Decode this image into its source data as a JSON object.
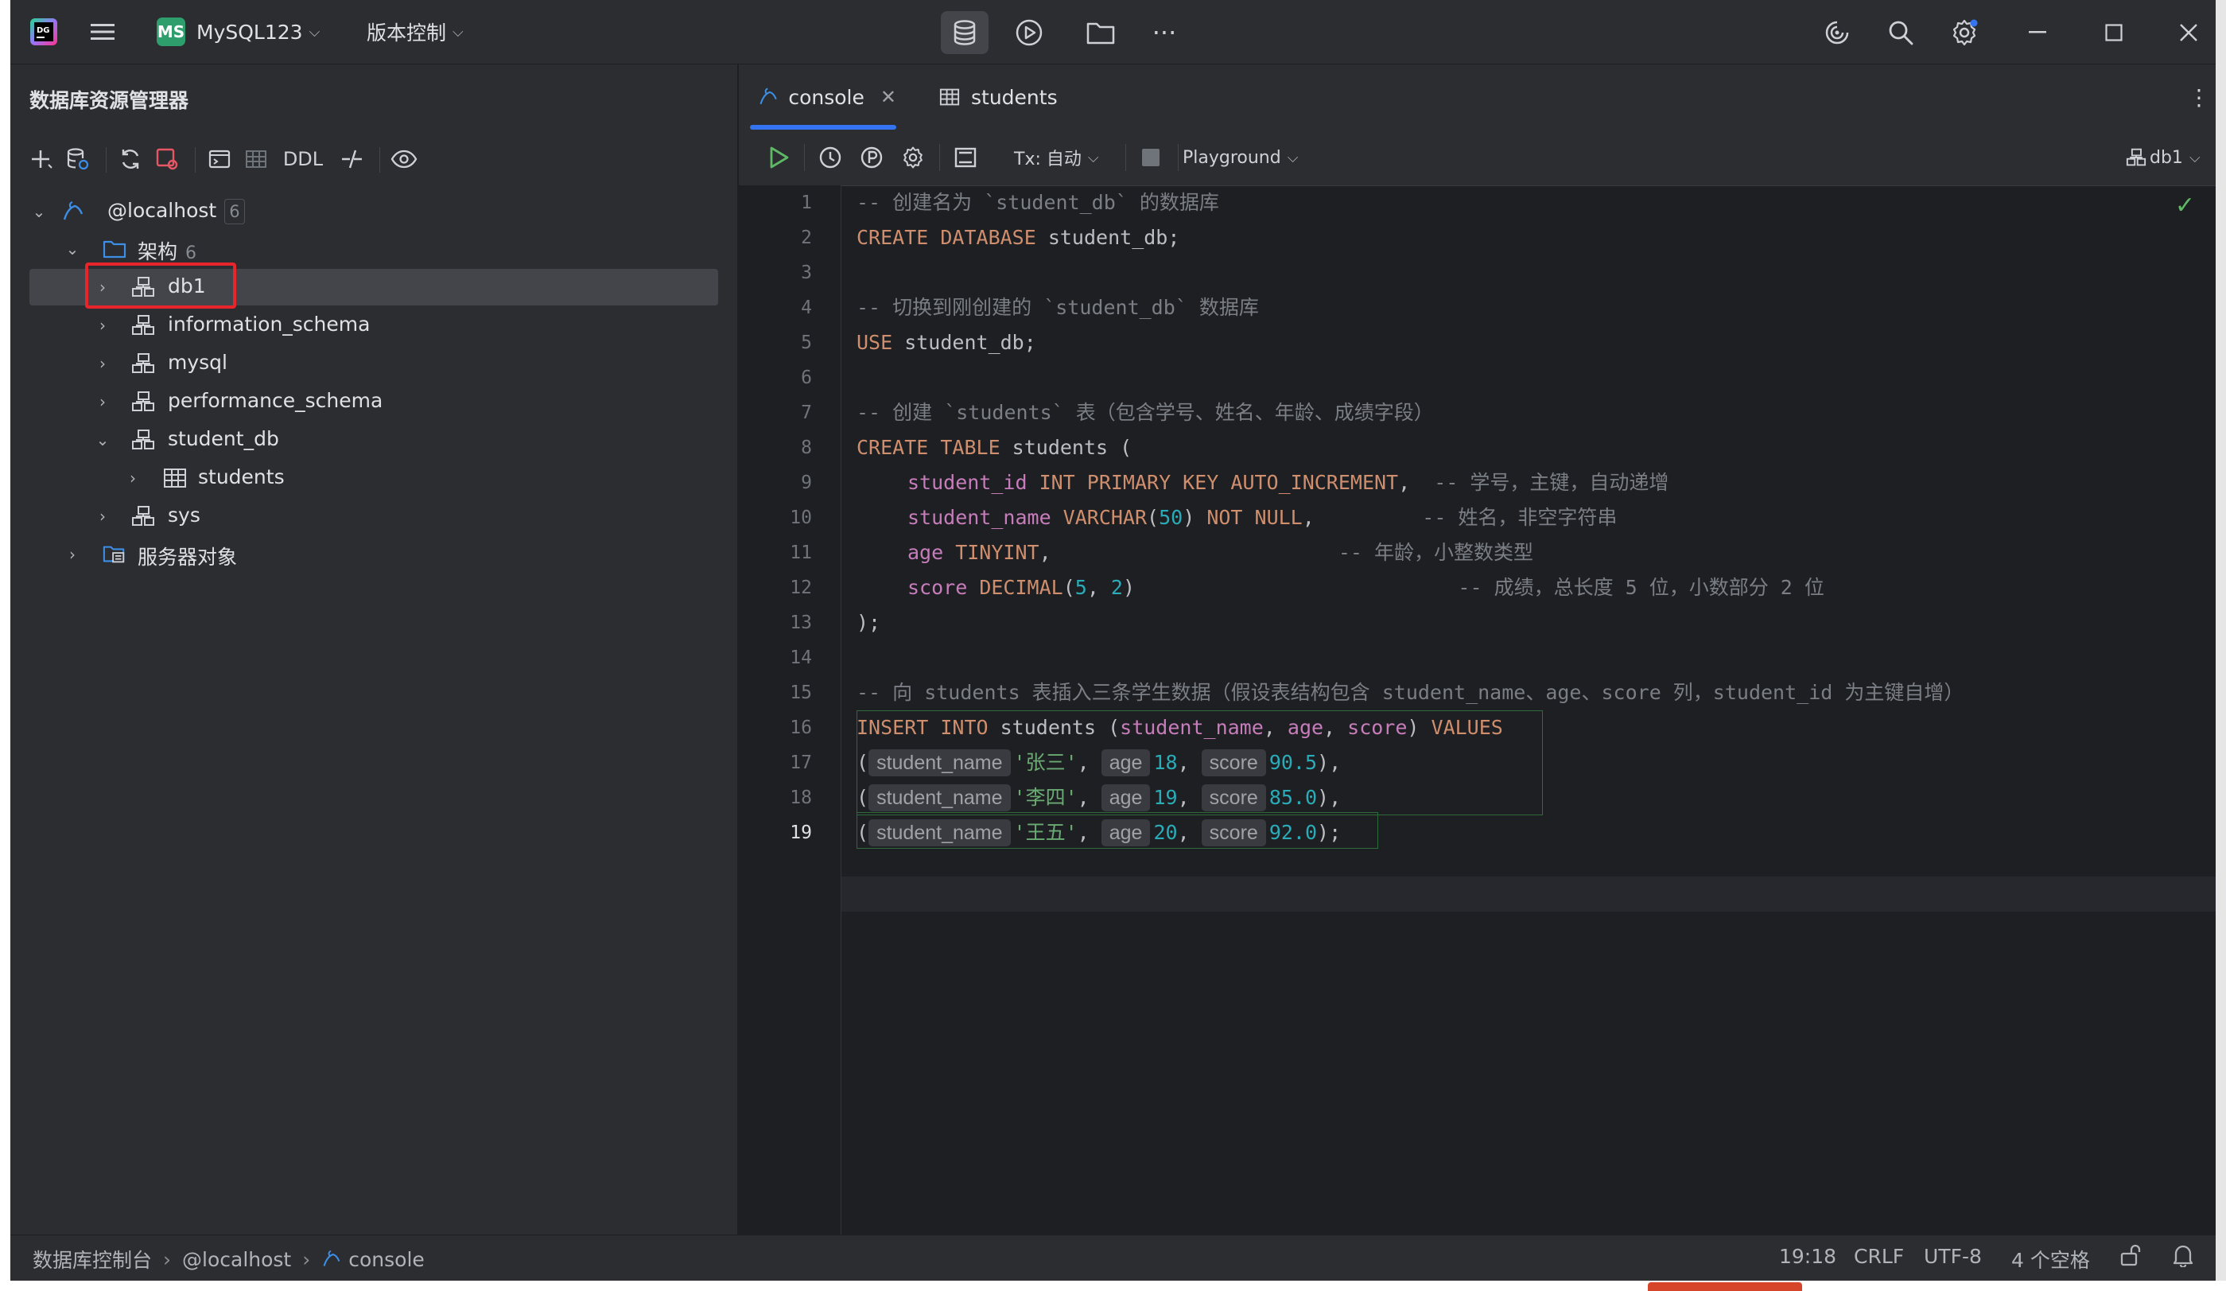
{
  "titlebar": {
    "project_badge": "MS",
    "project_name": "MySQL123",
    "vcs_label": "版本控制"
  },
  "left_panel": {
    "title": "数据库资源管理器",
    "toolbar_ddl": "DDL",
    "tree": {
      "root": {
        "label": "@localhost",
        "count": "6"
      },
      "schemas": {
        "label": "架构",
        "count": "6"
      },
      "items": [
        "db1",
        "information_schema",
        "mysql",
        "performance_schema",
        "student_db",
        "students",
        "sys"
      ],
      "server_objects": "服务器对象"
    }
  },
  "editor": {
    "tabs": [
      "console",
      "students"
    ],
    "toolbar": {
      "tx_label": "Tx: 自动",
      "playground": "Playground",
      "datasource": "db1"
    },
    "line_numbers": [
      "1",
      "2",
      "3",
      "4",
      "5",
      "6",
      "7",
      "8",
      "9",
      "10",
      "11",
      "12",
      "13",
      "14",
      "15",
      "16",
      "17",
      "18",
      "19"
    ],
    "lines": {
      "l1": "-- 创建名为 `student_db` 的数据库",
      "l2_kw": "CREATE DATABASE",
      "l2_rest": " student_db;",
      "l4": "-- 切换到刚创建的 `student_db` 数据库",
      "l5_kw": "USE",
      "l5_rest": " student_db;",
      "l7": "-- 创建 `students` 表（包含学号、姓名、年龄、成绩字段）",
      "l8_kw": "CREATE TABLE",
      "l8_rest": " students (",
      "l9_col": "student_id",
      "l9_kw": " INT PRIMARY KEY AUTO_INCREMENT",
      "l9_pl": ",  ",
      "l9_cm": "-- 学号，主键，自动递增",
      "l10_col": "student_name",
      "l10_kw": " VARCHAR",
      "l10_p1": "(",
      "l10_num": "50",
      "l10_p2": ") ",
      "l10_kw2": "NOT NULL",
      "l10_pl": ",         ",
      "l10_cm": "-- 姓名，非空字符串",
      "l11_col": "age",
      "l11_kw": " TINYINT",
      "l11_pl": ",                        ",
      "l11_cm": "-- 年龄，小整数类型",
      "l12_col": "score",
      "l12_kw": " DECIMAL",
      "l12_p1": "(",
      "l12_n1": "5",
      "l12_p2": ", ",
      "l12_n2": "2",
      "l12_p3": ")                           ",
      "l12_cm": "-- 成绩，总长度 5 位，小数部分 2 位",
      "l13": ");",
      "l15": "-- 向 students 表插入三条学生数据（假设表结构包含 student_name、age、score 列，student_id 为主键自增）",
      "l16_kw": "INSERT INTO",
      "l16_t": " students (",
      "l16_c1": "student_name",
      "l16_s1": ", ",
      "l16_c2": "age",
      "l16_s2": ", ",
      "l16_c3": "score",
      "l16_p": ") ",
      "l16_kw2": "VALUES",
      "rows": [
        {
          "name": "'张三'",
          "age": "18",
          "score": "90.5",
          "end": "),"
        },
        {
          "name": "'李四'",
          "age": "19",
          "score": "85.0",
          "end": "),"
        },
        {
          "name": "'王五'",
          "age": "20",
          "score": "92.0",
          "end": ");"
        }
      ],
      "hint_name": "student_name",
      "hint_age": "age",
      "hint_score": "score"
    }
  },
  "statusbar": {
    "crumb1": "数据库控制台",
    "crumb2": "@localhost",
    "crumb3": "console",
    "position": "19:18",
    "line_sep": "CRLF",
    "encoding": "UTF-8",
    "indent": "4 个空格"
  },
  "colors": {
    "accent": "#3574f0",
    "highlight_box": "#e8252a",
    "project_badge": "#2f9e6d"
  }
}
